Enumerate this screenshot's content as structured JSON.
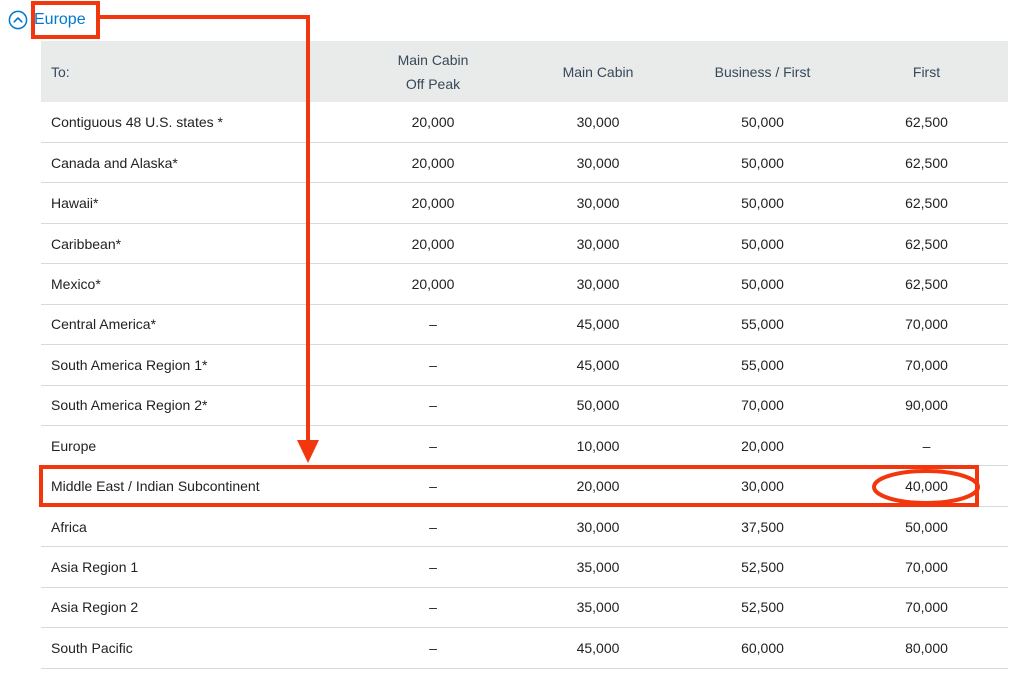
{
  "section": {
    "toggle_label": "Europe",
    "toggle_icon": "chevron-up-circle-icon"
  },
  "table": {
    "headers": {
      "dest": "To:",
      "off_peak_line1": "Main Cabin",
      "off_peak_line2": "Off Peak",
      "main_cabin": "Main Cabin",
      "business_first": "Business / First",
      "first": "First"
    },
    "rows": [
      {
        "dest": "Contiguous 48 U.S. states *",
        "off_peak": "20,000",
        "main": "30,000",
        "business": "50,000",
        "first": "62,500"
      },
      {
        "dest": "Canada and Alaska*",
        "off_peak": "20,000",
        "main": "30,000",
        "business": "50,000",
        "first": "62,500"
      },
      {
        "dest": "Hawaii*",
        "off_peak": "20,000",
        "main": "30,000",
        "business": "50,000",
        "first": "62,500"
      },
      {
        "dest": "Caribbean*",
        "off_peak": "20,000",
        "main": "30,000",
        "business": "50,000",
        "first": "62,500"
      },
      {
        "dest": "Mexico*",
        "off_peak": "20,000",
        "main": "30,000",
        "business": "50,000",
        "first": "62,500"
      },
      {
        "dest": "Central America*",
        "off_peak": "–",
        "main": "45,000",
        "business": "55,000",
        "first": "70,000"
      },
      {
        "dest": "South America Region 1*",
        "off_peak": "–",
        "main": "45,000",
        "business": "55,000",
        "first": "70,000"
      },
      {
        "dest": "South America Region 2*",
        "off_peak": "–",
        "main": "50,000",
        "business": "70,000",
        "first": "90,000"
      },
      {
        "dest": "Europe",
        "off_peak": "–",
        "main": "10,000",
        "business": "20,000",
        "first": "–"
      },
      {
        "dest": "Middle East / Indian Subcontinent",
        "off_peak": "–",
        "main": "20,000",
        "business": "30,000",
        "first": "40,000"
      },
      {
        "dest": "Africa",
        "off_peak": "–",
        "main": "30,000",
        "business": "37,500",
        "first": "50,000"
      },
      {
        "dest": "Asia Region 1",
        "off_peak": "–",
        "main": "35,000",
        "business": "52,500",
        "first": "70,000"
      },
      {
        "dest": "Asia Region 2",
        "off_peak": "–",
        "main": "35,000",
        "business": "52,500",
        "first": "70,000"
      },
      {
        "dest": "South Pacific",
        "off_peak": "–",
        "main": "45,000",
        "business": "60,000",
        "first": "80,000"
      }
    ]
  },
  "colors": {
    "link_blue": "#0078d2",
    "header_bg": "#e9eaea",
    "annotation_red": "#f2360e",
    "row_divider": "#d7d9da"
  }
}
